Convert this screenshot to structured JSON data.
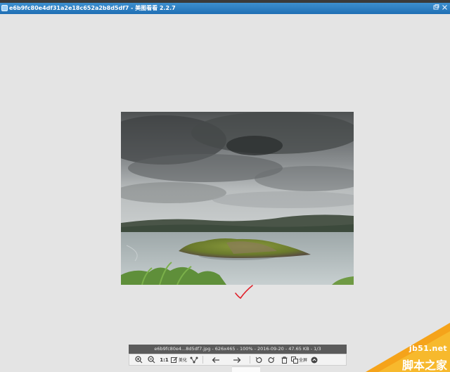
{
  "window": {
    "title": "e6b9fc80e4df31a2e18c652a2b8d5df7 - 美图看看 2.2.7"
  },
  "infobar": {
    "text": "e6b9fc80e4...8d5df7.jpg - 626x465 - 100% - 2016-09-20 - 47.65 KB - 1/3"
  },
  "toolbar": {
    "original_size_label": "1:1",
    "beautify_label": "美化",
    "toolbox_label": "全屏"
  },
  "watermark": {
    "site": "jb51.net",
    "name": "脚本之家"
  },
  "colors": {
    "titlebar": "#2a7fc2",
    "background": "#e4e4e4",
    "check_mark": "#e0202a"
  }
}
